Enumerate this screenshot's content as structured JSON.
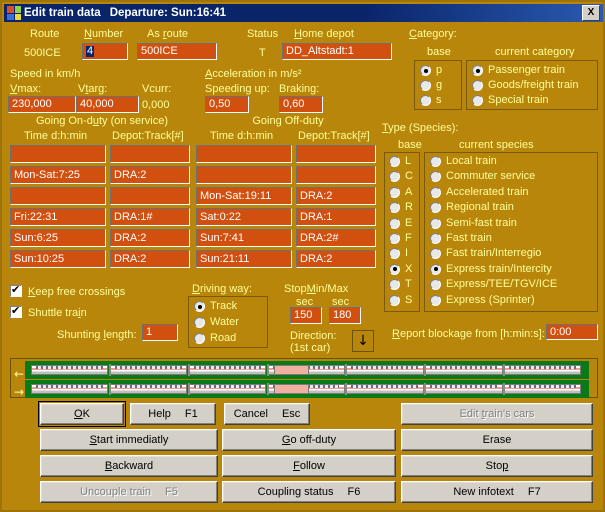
{
  "window": {
    "title": "Edit train data",
    "subtitle": "Departure: Sun:16:41",
    "close_label": "X",
    "icon": "app-icon"
  },
  "header": {
    "route_label": "Route",
    "route_value": "500ICE",
    "number_label": "Number",
    "number_value": "4",
    "as_route_label": "As route",
    "as_route_value": "500ICE",
    "status_label": "Status",
    "status_value": "T",
    "home_depot_label": "Home depot",
    "home_depot_value": "DD_Altstadt:1"
  },
  "speed": {
    "section_label": "Speed in km/h",
    "vmax_label": "Vmax:",
    "vmax_value": "230,000",
    "vtarg_label": "Vtarg:",
    "vtarg_value": "40,000",
    "vcurr_label": "Vcurr:",
    "vcurr_value": "0,000"
  },
  "acceleration": {
    "section_label": "Acceleration in m/s²",
    "speeding_up_label": "Speeding up:",
    "speeding_up_value": "0,50",
    "braking_label": "Braking:",
    "braking_value": "0,60"
  },
  "duty": {
    "on_duty_title": "Going On-duty (on service)",
    "off_duty_title": "Going Off-duty",
    "col_time": "Time   d:h:min",
    "col_depot": "Depot:Track[#]",
    "on_duty_rows": [
      {
        "time": "",
        "depot": ""
      },
      {
        "time": "Mon-Sat:7:25",
        "depot": "DRA:2"
      },
      {
        "time": "",
        "depot": ""
      },
      {
        "time": "Fri:22:31",
        "depot": "DRA:1#"
      },
      {
        "time": "Sun:6:25",
        "depot": "DRA:2"
      },
      {
        "time": "Sun:10:25",
        "depot": "DRA:2"
      }
    ],
    "off_duty_rows": [
      {
        "time": "",
        "depot": ""
      },
      {
        "time": "",
        "depot": ""
      },
      {
        "time": "Mon-Sat:19:11",
        "depot": "DRA:2"
      },
      {
        "time": "Sat:0:22",
        "depot": "DRA:1"
      },
      {
        "time": "Sun:7:41",
        "depot": "DRA:2#"
      },
      {
        "time": "Sun:21:11",
        "depot": "DRA:2"
      }
    ]
  },
  "category": {
    "title": "Category:",
    "base_label": "base",
    "current_label": "current category",
    "base_options": [
      "p",
      "g",
      "s"
    ],
    "base_selected": 0,
    "current_options": [
      "Passenger train",
      "Goods/freight train",
      "Special train"
    ],
    "current_selected": 0
  },
  "species": {
    "title": "Type (Species):",
    "base_label": "base",
    "current_label": "current species",
    "base_options": [
      "L",
      "C",
      "A",
      "R",
      "E",
      "F",
      "I",
      "X",
      "T",
      "S"
    ],
    "base_selected": 7,
    "current_options": [
      "Local train",
      "Commuter service",
      "Accelerated train",
      "Regional train",
      "Semi-fast train",
      "Fast train",
      "Fast train/Interregio",
      "Express train/Intercity",
      "Express/TEE/TGV/ICE",
      "Express (Sprinter)"
    ],
    "current_selected": 7
  },
  "options": {
    "keep_free_crossings_label": "Keep free crossings",
    "keep_free_crossings_checked": true,
    "shuttle_train_label": "Shuttle train",
    "shuttle_train_checked": true,
    "shunting_length_label": "Shunting length:",
    "shunting_length_value": "1"
  },
  "driving_way": {
    "title": "Driving way:",
    "options": [
      "Track",
      "Water",
      "Road"
    ],
    "selected": 0
  },
  "stop": {
    "title": "StopMin/Max",
    "unit_min": "sec",
    "unit_max": "sec",
    "min_value": "150",
    "max_value": "180"
  },
  "direction": {
    "label_line1": "Direction:",
    "label_line2": "(1st car)",
    "arrow": "↓"
  },
  "blockage": {
    "label": "Report blockage from [h:min:s]:",
    "value": "0:00"
  },
  "train_preview": {
    "top_arrow": "←",
    "bottom_arrow": "→",
    "rows": 2
  },
  "buttons": {
    "ok": "OK",
    "help": "Help",
    "help_key": "F1",
    "cancel": "Cancel",
    "cancel_key": "Esc",
    "edit_cars": "Edit train's cars",
    "start_immediatly": "Start immediatly",
    "go_off_duty": "Go off-duty",
    "erase": "Erase",
    "backward": "Backward",
    "follow": "Follow",
    "stop": "Stop",
    "uncouple_train": "Uncouple train",
    "uncouple_key": "F5",
    "coupling_status": "Coupling status",
    "coupling_key": "F6",
    "new_infotext": "New infotext",
    "infotext_key": "F7"
  },
  "colors": {
    "window_bg": "#b8860b",
    "field_bg": "#d2500f",
    "label_fg": "#ffff99",
    "titlebar": "#0a246a",
    "track_green": "#0a7a18",
    "button_face": "#d4d0c8"
  }
}
